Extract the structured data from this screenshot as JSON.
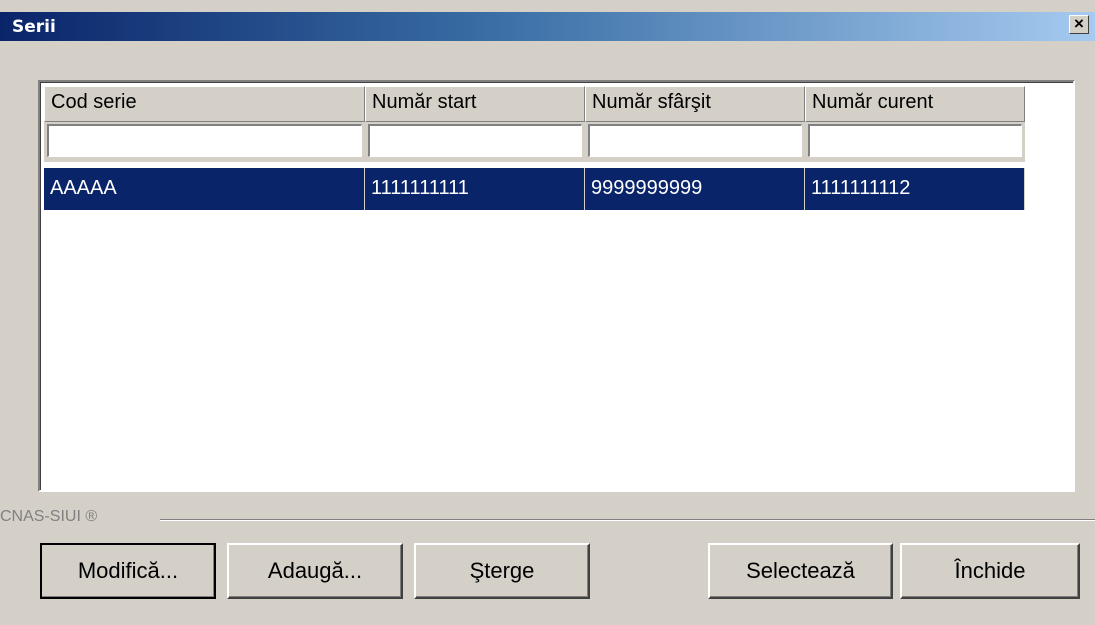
{
  "window": {
    "title": "Serii",
    "close_glyph": "×"
  },
  "table": {
    "columns": [
      "Cod serie",
      "Număr start",
      "Număr sfârşit",
      "Număr curent"
    ],
    "rows": [
      [
        "AAAAA",
        "1111111111",
        "9999999999",
        "1111111112"
      ]
    ],
    "selected_row_color": "#0a246a"
  },
  "footer": {
    "brand": "CNAS-SIUI ®"
  },
  "buttons": {
    "modify": "Modifică...",
    "add": "Adaugă...",
    "delete": "Şterge",
    "select": "Selectează",
    "close": "Închide"
  }
}
